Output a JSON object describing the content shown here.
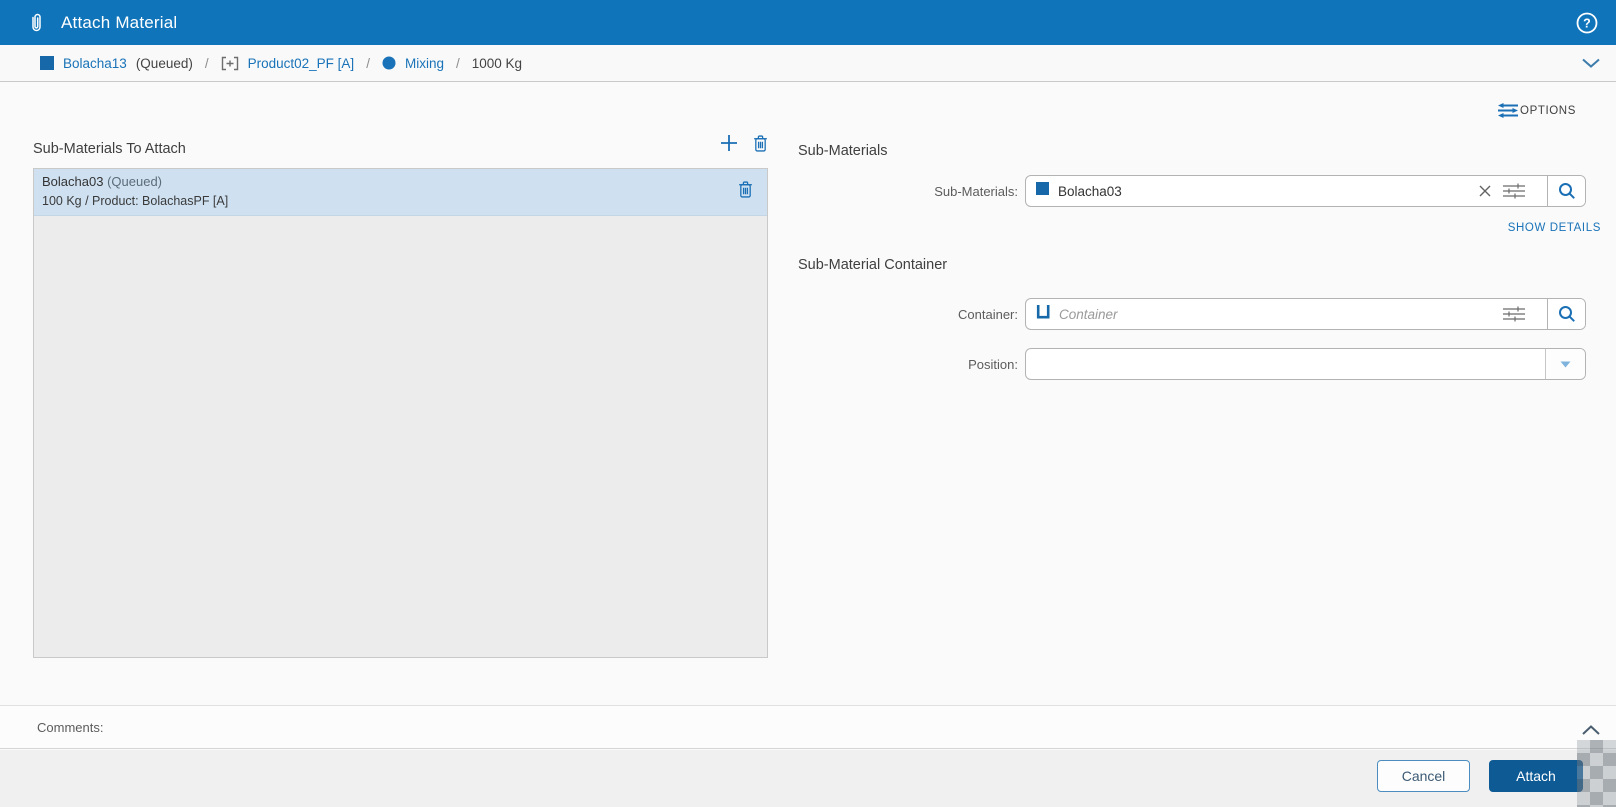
{
  "titlebar": {
    "title": "Attach Material"
  },
  "breadcrumb": {
    "separator": "/",
    "material": {
      "name": "Bolacha13",
      "status": "(Queued)"
    },
    "product": "Product02_PF [A]",
    "step": "Mixing",
    "quantity": "1000 Kg"
  },
  "options": {
    "label": "OPTIONS"
  },
  "left_panel": {
    "title": "Sub-Materials To Attach",
    "items": [
      {
        "name": "Bolacha03",
        "status": "(Queued)",
        "details": "100 Kg / Product: BolachasPF [A]"
      }
    ]
  },
  "right_panel": {
    "sub_materials": {
      "section_title": "Sub-Materials",
      "label": "Sub-Materials:",
      "value": "Bolacha03",
      "show_details": "SHOW DETAILS"
    },
    "container": {
      "section_title": "Sub-Material Container",
      "label": "Container:",
      "placeholder": "Container"
    },
    "position": {
      "label": "Position:"
    }
  },
  "comments": {
    "label": "Comments:"
  },
  "footer": {
    "cancel": "Cancel",
    "attach": "Attach"
  },
  "colors": {
    "header_blue": "#0f74ba",
    "link_blue": "#1a73b8",
    "icon_blue": "#1668a8",
    "accent_blue": "#1a6fb5",
    "attach_button_blue": "#0d5a94",
    "selected_item_bg": "#cfe1f1"
  }
}
